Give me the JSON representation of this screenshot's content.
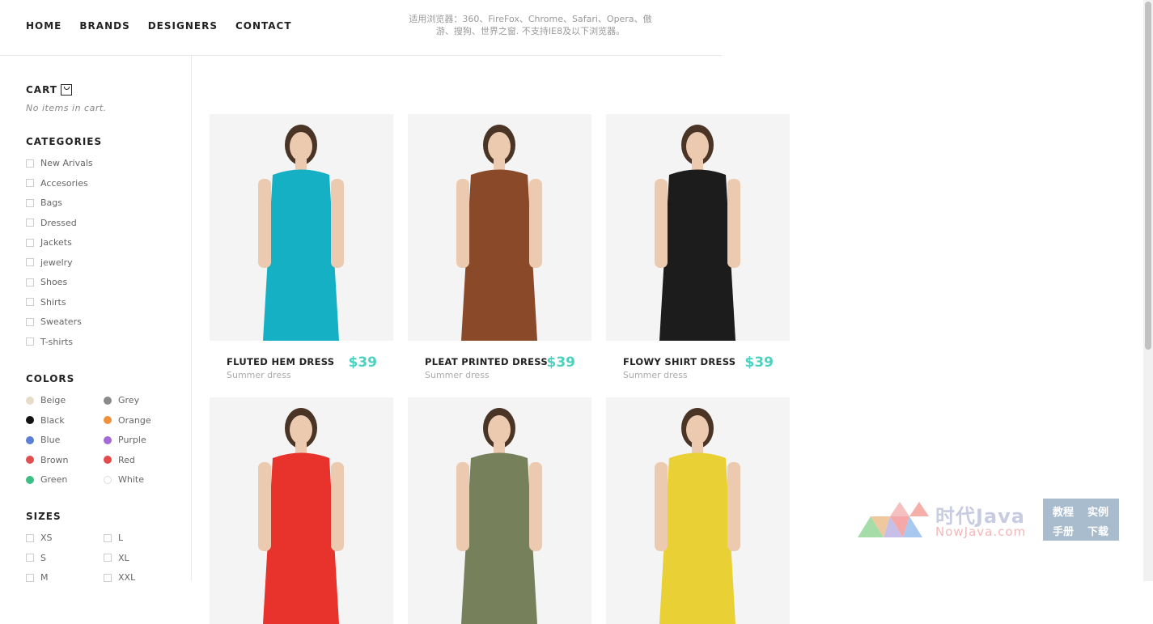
{
  "nav": {
    "items": [
      "HOME",
      "BRANDS",
      "DESIGNERS",
      "CONTACT"
    ]
  },
  "notice": "适用浏览器：360、FireFox、Chrome、Safari、Opera、傲游、搜狗、世界之窗. 不支持IE8及以下浏览器。",
  "cart": {
    "title": "CART",
    "empty_text": "No items in cart."
  },
  "categories": {
    "title": "CATEGORIES",
    "items": [
      "New Arivals",
      "Accesories",
      "Bags",
      "Dressed",
      "Jackets",
      "jewelry",
      "Shoes",
      "Shirts",
      "Sweaters",
      "T-shirts"
    ]
  },
  "colors": {
    "title": "COLORS",
    "items": [
      {
        "label": "Beige",
        "color": "#e8dcc8"
      },
      {
        "label": "Grey",
        "color": "#8a8a8a"
      },
      {
        "label": "Black",
        "color": "#111111"
      },
      {
        "label": "Orange",
        "color": "#f0913c"
      },
      {
        "label": "Blue",
        "color": "#5b7fd6"
      },
      {
        "label": "Purple",
        "color": "#a46ad8"
      },
      {
        "label": "Brown",
        "color": "#e15050"
      },
      {
        "label": "Red",
        "color": "#e44b4b"
      },
      {
        "label": "Green",
        "color": "#3cbf85"
      },
      {
        "label": "White",
        "color": "#ffffff"
      }
    ]
  },
  "sizes": {
    "title": "SIZES",
    "items": [
      "XS",
      "L",
      "S",
      "XL",
      "M",
      "XXL"
    ]
  },
  "products": [
    {
      "name": "FLUTED HEM DRESS",
      "sub": "Summer dress",
      "price": "$39",
      "garment": "#16b0c4"
    },
    {
      "name": "PLEAT PRINTED DRESS",
      "sub": "Summer dress",
      "price": "$39",
      "garment": "#8a4a2a"
    },
    {
      "name": "FLOWY SHIRT DRESS",
      "sub": "Summer dress",
      "price": "$39",
      "garment": "#1c1c1c"
    },
    {
      "name": "",
      "sub": "",
      "price": "",
      "garment": "#e8332d"
    },
    {
      "name": "",
      "sub": "",
      "price": "",
      "garment": "#76805a"
    },
    {
      "name": "",
      "sub": "",
      "price": "",
      "garment": "#e8d035"
    }
  ],
  "watermark": {
    "title": "时代Java",
    "url": "NowJava.com",
    "box": [
      "教程",
      "实例",
      "手册",
      "下载"
    ]
  }
}
